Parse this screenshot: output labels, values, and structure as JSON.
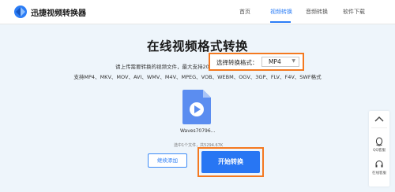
{
  "header": {
    "logo_text": "迅捷视频转换器",
    "nav": [
      "首页",
      "视频转换",
      "音频转换",
      "软件下载"
    ],
    "active_nav": "视频转换"
  },
  "main": {
    "title": "在线视频格式转换",
    "upload_hint": "请上传需要转换的视频文件，最大支持20M",
    "supported_formats": "支持MP4、MKV、MOV、AVI、WMV、M4V、MPEG、VOB、WEBM、OGV、3GP、FLV、F4V、SWF格式"
  },
  "format_selector": {
    "label": "选择转换格式：",
    "value": "MP4"
  },
  "file": {
    "name": "Waves70796...",
    "info": "选中1个文件，共5294.67K"
  },
  "buttons": {
    "continue": "继续添加",
    "start": "开始转换"
  },
  "side_panel": {
    "qq_label": "QQ客服",
    "online_label": "在线客服"
  },
  "colors": {
    "accent": "#2b7df6",
    "highlight": "#f47920",
    "background": "#eef5fb"
  }
}
